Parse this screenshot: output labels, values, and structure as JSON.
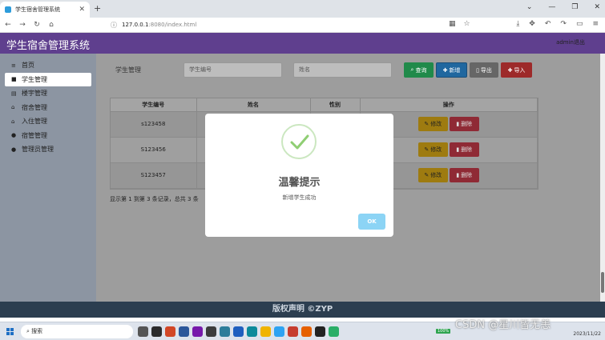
{
  "browser": {
    "tab_title": "学生宿舍管理系统",
    "tab_close": "✕",
    "new_tab": "+",
    "url_host": "127.0.0.1",
    "url_path": ":8080/index.html",
    "window_controls": [
      "⌄",
      "—",
      "❐",
      "✕"
    ]
  },
  "app": {
    "title": "学生宿舍管理系统",
    "logout_label": "admin退出"
  },
  "sidebar": {
    "items": [
      {
        "icon": "menu-icon",
        "glyph": "≡",
        "label": "首页"
      },
      {
        "icon": "user-icon",
        "glyph": "■",
        "label": "学生管理"
      },
      {
        "icon": "building-icon",
        "glyph": "▤",
        "label": "楼宇管理"
      },
      {
        "icon": "home-icon",
        "glyph": "⌂",
        "label": "宿舍管理"
      },
      {
        "icon": "home-icon",
        "glyph": "⌂",
        "label": "入住管理"
      },
      {
        "icon": "person-icon",
        "glyph": "●",
        "label": "宿管管理"
      },
      {
        "icon": "person-icon",
        "glyph": "●",
        "label": "管理员管理"
      }
    ]
  },
  "search": {
    "label": "学生管理",
    "student_id_placeholder": "学生编号",
    "name_placeholder": "姓名",
    "query_label": "查询",
    "add_label": "新增",
    "export_label": "导出",
    "import_label": "导入"
  },
  "table": {
    "headers": [
      "学生编号",
      "姓名",
      "性别",
      "操作"
    ],
    "rows": [
      {
        "id": "s123458",
        "name": "",
        "gender": ""
      },
      {
        "id": "S123456",
        "name": "",
        "gender": ""
      },
      {
        "id": "S123457",
        "name": "",
        "gender": ""
      }
    ],
    "edit_label": "修改",
    "delete_label": "删除",
    "pager_text": "显示第 1 到第 3 条记录，总共 3 条"
  },
  "modal": {
    "title": "温馨提示",
    "message": "新增学生成功",
    "ok_label": "OK"
  },
  "footer": {
    "text": "版权声明 ©ZYP"
  },
  "taskbar": {
    "search_label": "搜索",
    "date": "2023/11/22",
    "battery": "100%"
  },
  "watermark": "CSDN @星川皆无恙",
  "colors": {
    "header": "#5f3f8e",
    "query": "#28a745",
    "add": "#2a7fc8",
    "delete": "#c0394a",
    "edit": "#e0a800",
    "ok": "#8cd4f5"
  }
}
